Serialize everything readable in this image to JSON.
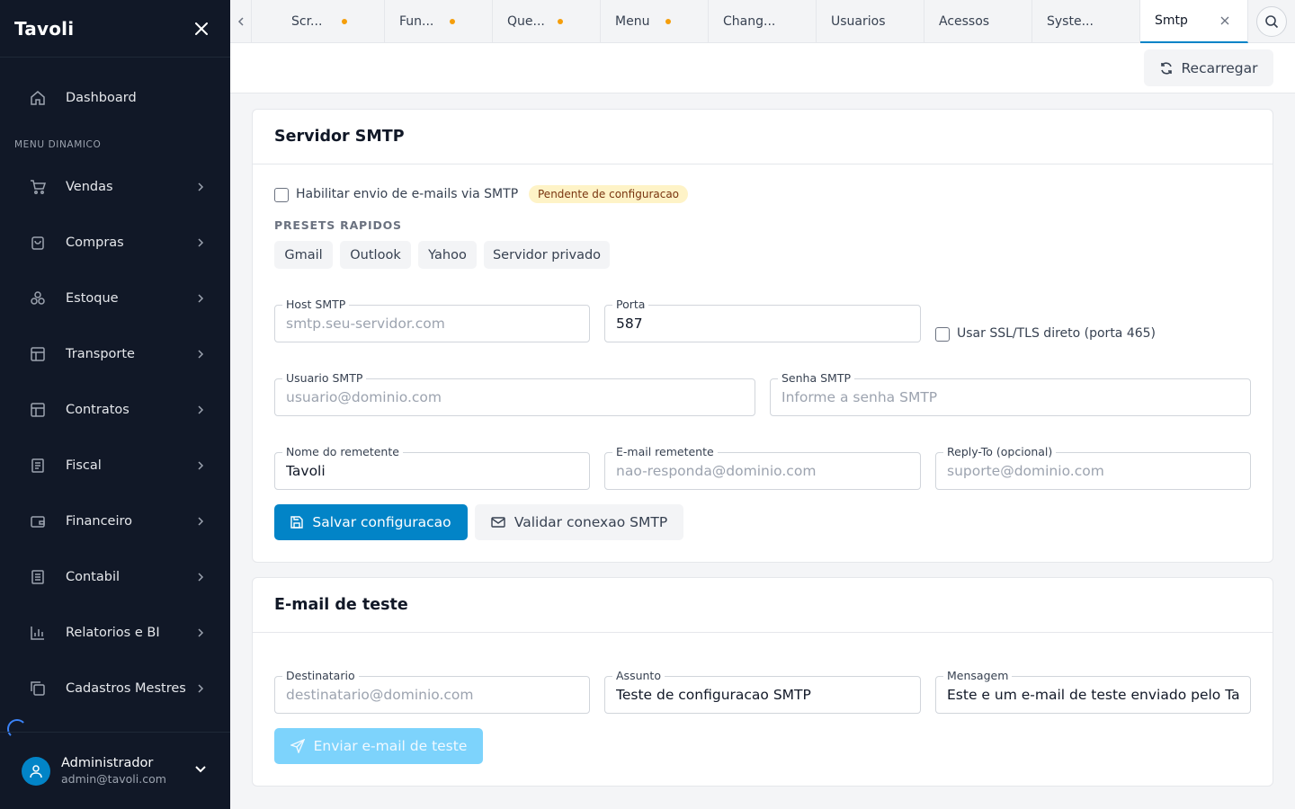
{
  "app": {
    "brand": "Tavoli"
  },
  "sidebar": {
    "dashboard": "Dashboard",
    "section_title": "MENU DINAMICO",
    "items": [
      {
        "label": "Vendas",
        "icon": "cart-icon"
      },
      {
        "label": "Compras",
        "icon": "bag-icon"
      },
      {
        "label": "Estoque",
        "icon": "boxes-icon"
      },
      {
        "label": "Transporte",
        "icon": "table-icon"
      },
      {
        "label": "Contratos",
        "icon": "table-icon"
      },
      {
        "label": "Fiscal",
        "icon": "receipt-icon"
      },
      {
        "label": "Financeiro",
        "icon": "wallet-icon"
      },
      {
        "label": "Contabil",
        "icon": "ledger-icon"
      },
      {
        "label": "Relatorios e BI",
        "icon": "chart-icon"
      },
      {
        "label": "Cadastros Mestres",
        "icon": "copy-icon"
      }
    ],
    "user": {
      "name": "Administrador",
      "email": "admin@tavoli.com"
    }
  },
  "tabs": [
    {
      "label": "Scr...",
      "dirty": true
    },
    {
      "label": "Fun...",
      "dirty": true
    },
    {
      "label": "Que...",
      "dirty": true
    },
    {
      "label": "Menu",
      "dirty": true
    },
    {
      "label": "Chang...",
      "dirty": false
    },
    {
      "label": "Usuarios",
      "dirty": false
    },
    {
      "label": "Acessos",
      "dirty": false
    },
    {
      "label": "Syste...",
      "dirty": false
    },
    {
      "label": "Smtp",
      "dirty": false,
      "active": true
    }
  ],
  "toolbar": {
    "reload_label": "Recarregar"
  },
  "smtp": {
    "title": "Servidor SMTP",
    "enable_label": "Habilitar envio de e-mails via SMTP",
    "status_badge": "Pendente de configuracao",
    "presets_title": "PRESETS RAPIDOS",
    "presets": [
      "Gmail",
      "Outlook",
      "Yahoo",
      "Servidor privado"
    ],
    "host": {
      "label": "Host SMTP",
      "value": "",
      "placeholder": "smtp.seu-servidor.com"
    },
    "port": {
      "label": "Porta",
      "value": "587",
      "placeholder": ""
    },
    "ssl_label": "Usar SSL/TLS direto (porta 465)",
    "user": {
      "label": "Usuario SMTP",
      "value": "",
      "placeholder": "usuario@dominio.com"
    },
    "password": {
      "label": "Senha SMTP",
      "value": "",
      "placeholder": "Informe a senha SMTP"
    },
    "sender_name": {
      "label": "Nome do remetente",
      "value": "Tavoli",
      "placeholder": ""
    },
    "sender_email": {
      "label": "E-mail remetente",
      "value": "",
      "placeholder": "nao-responda@dominio.com"
    },
    "reply_to": {
      "label": "Reply-To (opcional)",
      "value": "",
      "placeholder": "suporte@dominio.com"
    },
    "save_label": "Salvar configuracao",
    "validate_label": "Validar conexao SMTP"
  },
  "test": {
    "title": "E-mail de teste",
    "recipient": {
      "label": "Destinatario",
      "value": "",
      "placeholder": "destinatario@dominio.com"
    },
    "subject": {
      "label": "Assunto",
      "value": "Teste de configuracao SMTP",
      "placeholder": ""
    },
    "message": {
      "label": "Mensagem",
      "value": "Este e um e-mail de teste enviado pelo Tavoli.",
      "placeholder": ""
    },
    "send_label": "Enviar e-mail de teste"
  },
  "colors": {
    "sidebar_bg": "#111827",
    "primary": "#0284c7",
    "badge_bg": "#fef3c7",
    "dot": "#f59e0b"
  }
}
